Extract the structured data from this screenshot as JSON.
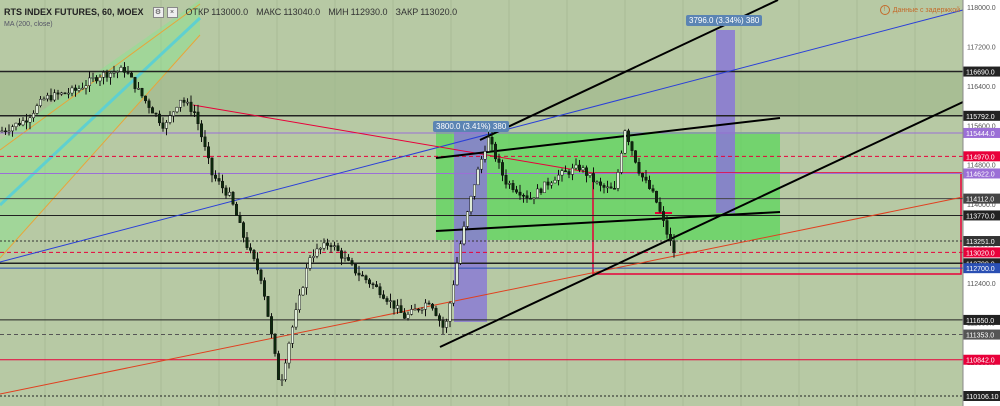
{
  "header": {
    "symbol": "RTS INDEX FUTURES, 60, MOEX",
    "open_label": "ОТКР",
    "open": "113000.0",
    "high_label": "МАКС",
    "high": "113040.0",
    "low_label": "МИН",
    "low": "112930.0",
    "close_label": "ЗАКР",
    "close": "113020.0",
    "indicator": "MA (200, close)",
    "live_text": "Данные с задержкой"
  },
  "measure_labels": [
    "3800.0 (3.41%) 380",
    "3796.0 (3.34%) 380"
  ],
  "colors": {
    "bg": "#b7c9a4",
    "green_zone": "#5cd65c",
    "purple": "#9b6fd6",
    "red": "#e8003a",
    "channel": "#5fd0d0"
  },
  "chart_data": {
    "type": "candlestick",
    "ylim": [
      110106.1,
      118000
    ],
    "price_ticks": [
      "118000.0",
      "117200.0",
      "116400.0",
      "115600.0",
      "114800.0",
      "114000.0",
      "113200.0",
      "112400.0",
      "111600.0",
      "110800.0"
    ],
    "price_levels": [
      {
        "label": "116690.0",
        "color": "#222222"
      },
      {
        "label": "115792.0",
        "color": "#222222"
      },
      {
        "label": "115444.0",
        "color": "#9b6fd6"
      },
      {
        "label": "114970.0",
        "color": "#e8003a"
      },
      {
        "label": "114622.0",
        "color": "#9b6fd6"
      },
      {
        "label": "114112.0",
        "color": "#444444"
      },
      {
        "label": "113770.0",
        "color": "#222222"
      },
      {
        "label": "113251.0",
        "color": "#333333"
      },
      {
        "label": "113020.0",
        "color": "#e8003a"
      },
      {
        "label": "112799.0",
        "color": "#222222"
      },
      {
        "label": "112700.0",
        "color": "#2a4fb3"
      },
      {
        "label": "111650.0",
        "color": "#222222"
      },
      {
        "label": "111353.0",
        "color": "#555555"
      },
      {
        "label": "110842.0",
        "color": "#e8003a"
      },
      {
        "label": "110106.10",
        "color": "#222222"
      }
    ]
  }
}
